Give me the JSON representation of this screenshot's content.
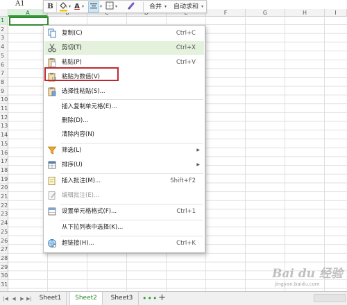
{
  "name_box": "A1",
  "columns": [
    "A",
    "B",
    "C",
    "D",
    "E",
    "F",
    "G",
    "H",
    "I"
  ],
  "rows": [
    "1",
    "2",
    "3",
    "4",
    "5",
    "6",
    "7",
    "8",
    "9",
    "10",
    "11",
    "12",
    "13",
    "14",
    "15",
    "16",
    "17",
    "18",
    "19",
    "20",
    "21",
    "22",
    "23",
    "24",
    "25",
    "26",
    "27",
    "28",
    "29",
    "30",
    "31",
    "32"
  ],
  "toolbar": {
    "bold": "B",
    "font_color": "A",
    "merge": "合并",
    "autosum": "自动求和"
  },
  "menu": {
    "copy": {
      "label": "复制(C)",
      "shortcut": "Ctrl+C"
    },
    "cut": {
      "label": "剪切(T)",
      "shortcut": "Ctrl+X"
    },
    "paste": {
      "label": "粘贴(P)",
      "shortcut": "Ctrl+V"
    },
    "paste_values": {
      "label": "粘贴为数值(V)"
    },
    "paste_special": {
      "label": "选择性粘贴(S)..."
    },
    "insert_copied": {
      "label": "插入复制单元格(E)..."
    },
    "delete": {
      "label": "删除(D)..."
    },
    "clear": {
      "label": "清除内容(N)"
    },
    "filter": {
      "label": "筛选(L)"
    },
    "sort": {
      "label": "排序(U)"
    },
    "insert_comment": {
      "label": "插入批注(M)...",
      "shortcut": "Shift+F2"
    },
    "edit_comment": {
      "label": "编辑批注(E)..."
    },
    "format_cells": {
      "label": "设置单元格格式(F)...",
      "shortcut": "Ctrl+1"
    },
    "pick_list": {
      "label": "从下拉列表中选择(K)..."
    },
    "hyperlink": {
      "label": "超链接(H)...",
      "shortcut": "Ctrl+K"
    }
  },
  "sheets": [
    "Sheet1",
    "Sheet2",
    "Sheet3"
  ],
  "active_sheet": "Sheet2",
  "watermark": {
    "logo": "Bai du 经验",
    "url": "jingyan.baidu.com"
  },
  "colors": {
    "accent": "#2e8b2e",
    "highlight_border": "#c0272d",
    "menu_hover": "#e4f2dd"
  }
}
